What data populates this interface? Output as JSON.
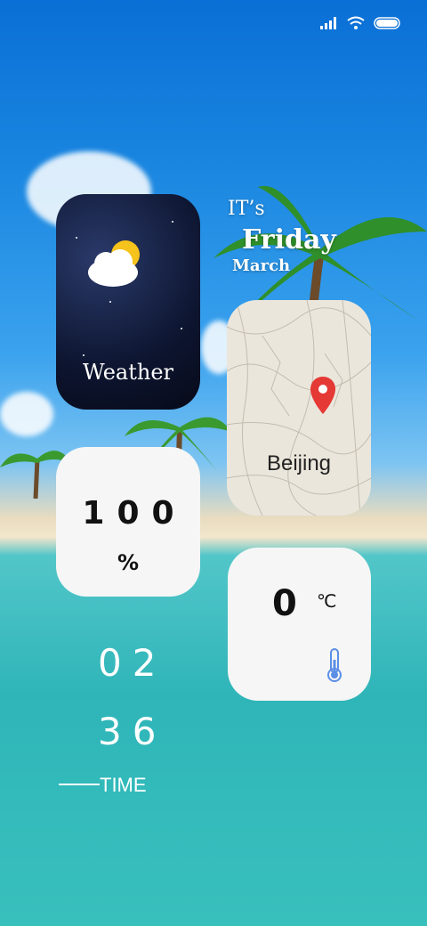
{
  "status": {
    "icons": [
      "signal-icon",
      "wifi-icon",
      "battery-icon"
    ]
  },
  "date": {
    "prefix": "IT’s",
    "day": "Friday",
    "month": "March"
  },
  "weather_widget": {
    "label": "Weather",
    "icon": "partly-cloudy-icon"
  },
  "map_widget": {
    "city": "Beijing",
    "icon": "location-pin-icon",
    "pin_color": "#e53935"
  },
  "battery_widget": {
    "value": "100",
    "unit": "%"
  },
  "temperature_widget": {
    "value": "0",
    "unit": "℃",
    "icon": "thermometer-icon"
  },
  "clock": {
    "hour": "02",
    "minute": "36",
    "label": "TIME"
  }
}
